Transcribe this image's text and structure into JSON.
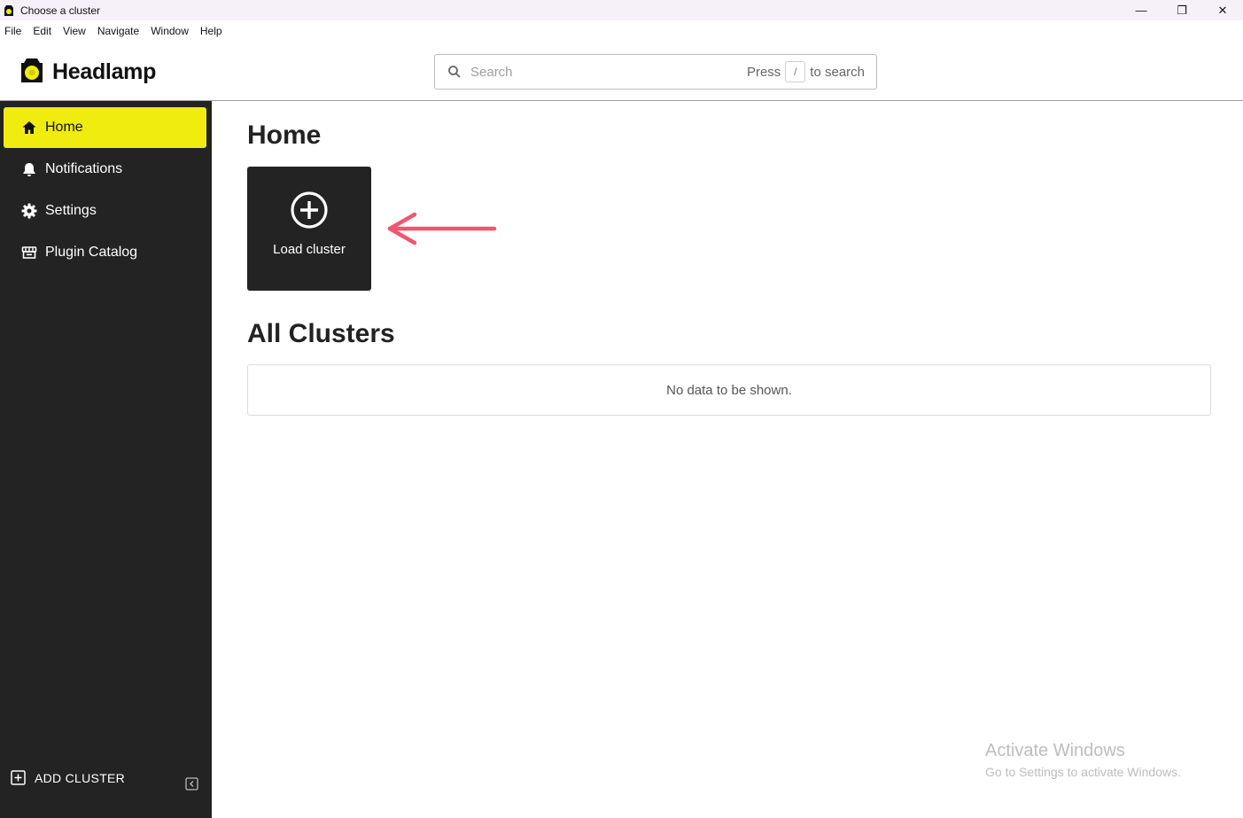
{
  "window": {
    "title": "Choose a cluster",
    "controls": {
      "minimize": "—",
      "restore": "❐",
      "close": "✕"
    }
  },
  "menubar": {
    "items": [
      "File",
      "Edit",
      "View",
      "Navigate",
      "Window",
      "Help"
    ]
  },
  "header": {
    "brand": "Headlamp",
    "search": {
      "placeholder": "Search",
      "hint_prefix": "Press",
      "hint_key": "/",
      "hint_suffix": "to search"
    }
  },
  "sidebar": {
    "items": [
      {
        "label": "Home",
        "icon": "home-icon",
        "active": true
      },
      {
        "label": "Notifications",
        "icon": "bell-icon",
        "active": false
      },
      {
        "label": "Settings",
        "icon": "gear-icon",
        "active": false
      },
      {
        "label": "Plugin Catalog",
        "icon": "store-icon",
        "active": false
      }
    ],
    "footer": {
      "add_cluster_label": "ADD CLUSTER"
    }
  },
  "main": {
    "title": "Home",
    "load_cluster_label": "Load cluster",
    "all_clusters_title": "All Clusters",
    "empty_text": "No data to be shown."
  },
  "watermark": {
    "title": "Activate Windows",
    "subtitle": "Go to Settings to activate Windows."
  },
  "colors": {
    "accent": "#f1ec0f",
    "sidebar_bg": "#232323",
    "annotation": "#f0566e"
  }
}
